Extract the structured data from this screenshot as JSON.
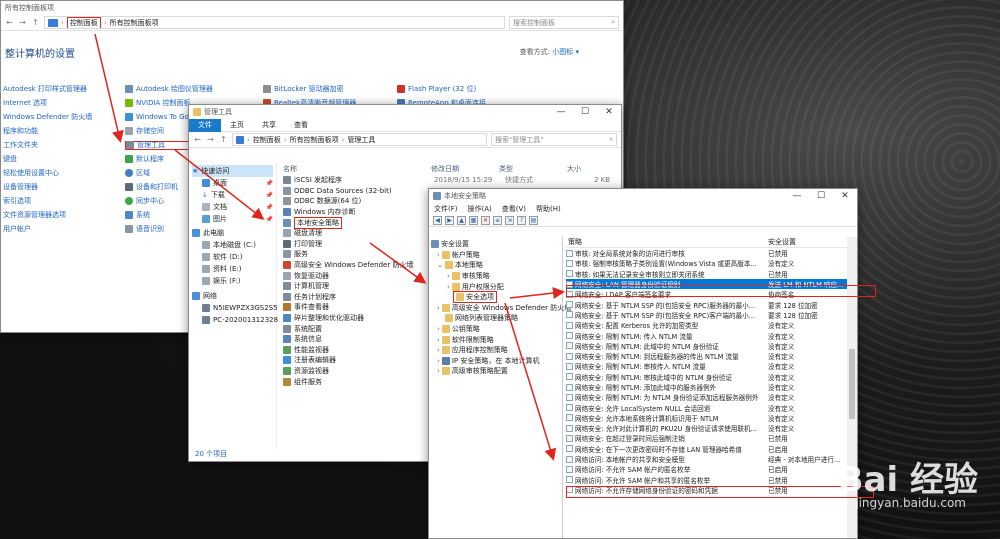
{
  "control_panel": {
    "title": "所有控制面板项",
    "breadcrumb": [
      "控制面板",
      "所有控制面板项"
    ],
    "search_placeholder": "搜索控制面板",
    "heading": "整计算机的设置",
    "view_by_label": "查看方式:",
    "view_by_value": "小图标 ▾",
    "col1": [
      "Autodesk 打印样式管理器",
      "Internet 选项",
      "Windows Defender 防火墙",
      "程序和功能",
      "工作文件夹",
      "键盘",
      "轻松使用设置中心",
      "设备管理器",
      "索引选项",
      "文件资源管理器选项",
      "用户帐户"
    ],
    "col2": [
      "Autodesk 绘图仪管理器",
      "NVIDIA 控制面板",
      "Windows To Go",
      "存储空间",
      "管理工具",
      "默认程序",
      "区域",
      "设备和打印机",
      "同步中心",
      "系统",
      "语音识别"
    ],
    "col3": [
      "BitLocker 驱动器加密",
      "Realtek高清晰音频管理器"
    ],
    "col4": [
      "Flash Player (32 位)",
      "RemoteApp 和桌面连接"
    ]
  },
  "admin_tools": {
    "title": "管理工具",
    "ribbon": [
      "文件",
      "主页",
      "共享",
      "查看"
    ],
    "breadcrumb": [
      "控制面板",
      "所有控制面板项",
      "管理工具"
    ],
    "search_placeholder": "搜索\"管理工具\"",
    "nav": [
      "快速访问",
      "桌面",
      "下载",
      "文档",
      "图片",
      "此电脑",
      "本地磁盘 (C:)",
      "软件 (D:)",
      "资料 (E:)",
      "娱乐 (F:)",
      "网络",
      "N5IEWPZX3GS2S5",
      "PC-202001312328"
    ],
    "col_name": "名称",
    "col_date": "修改日期",
    "col_type": "类型",
    "col_size": "大小",
    "first_row_date": "2018/9/15 15:29",
    "first_row_type": "快捷方式",
    "first_row_size": "2 KB",
    "items": [
      "iSCSI 发起程序",
      "ODBC Data Sources (32-bit)",
      "ODBC 数据源(64 位)",
      "Windows 内存诊断",
      "本地安全策略",
      "磁盘清理",
      "打印管理",
      "服务",
      "高级安全 Windows Defender 防火墙",
      "恢复驱动器",
      "计算机管理",
      "任务计划程序",
      "事件查看器",
      "碎片整理和优化驱动器",
      "系统配置",
      "系统信息",
      "性能监视器",
      "注册表编辑器",
      "资源监视器",
      "组件服务"
    ],
    "status": "20 个项目"
  },
  "local_policy": {
    "title": "本地安全策略",
    "menu": [
      "文件(F)",
      "操作(A)",
      "查看(V)",
      "帮助(H)"
    ],
    "tree": [
      "安全设置",
      "帐户策略",
      "本地策略",
      "审核策略",
      "用户权限分配",
      "安全选项",
      "高级安全 Windows Defender 防火墙",
      "网络列表管理器策略",
      "公钥策略",
      "软件限制策略",
      "应用程序控制策略",
      "IP 安全策略，在 本地计算机",
      "高级审核策略配置"
    ],
    "col_policy": "策略",
    "col_setting": "安全设置",
    "rows": [
      {
        "p": "审核: 对全局系统对象的访问进行审核",
        "s": "已禁用"
      },
      {
        "p": "审核: 强制审核策略子类别设置(Windows Vista 或更高版本...",
        "s": "没有定义"
      },
      {
        "p": "审核: 如果无法记录安全审核则立即关闭系统",
        "s": "已禁用"
      },
      {
        "p": "网络安全: LAN 管理器身份验证级别",
        "s": "发送 LM 和 NTLM 响应..."
      },
      {
        "p": "网络安全: LDAP 客户端签名要求",
        "s": "协商签名"
      },
      {
        "p": "网络安全: 基于 NTLM SSP 的(包括安全 RPC)服务器的最小...",
        "s": "要求 128 位加密"
      },
      {
        "p": "网络安全: 基于 NTLM SSP 的(包括安全 RPC)客户端的最小...",
        "s": "要求 128 位加密"
      },
      {
        "p": "网络安全: 配置 Kerberos 允许的加密类型",
        "s": "没有定义"
      },
      {
        "p": "网络安全: 限制 NTLM: 传入 NTLM 流量",
        "s": "没有定义"
      },
      {
        "p": "网络安全: 限制 NTLM: 此域中的 NTLM 身份验证",
        "s": "没有定义"
      },
      {
        "p": "网络安全: 限制 NTLM: 到远程服务器的传出 NTLM 流量",
        "s": "没有定义"
      },
      {
        "p": "网络安全: 限制 NTLM: 审核传入 NTLM 流量",
        "s": "没有定义"
      },
      {
        "p": "网络安全: 限制 NTLM: 审核此域中的 NTLM 身份验证",
        "s": "没有定义"
      },
      {
        "p": "网络安全: 限制 NTLM: 添加此域中的服务器例外",
        "s": "没有定义"
      },
      {
        "p": "网络安全: 限制 NTLM: 为 NTLM 身份验证添加远程服务器例外",
        "s": "没有定义"
      },
      {
        "p": "网络安全: 允许 LocalSystem NULL 会话回退",
        "s": "没有定义"
      },
      {
        "p": "网络安全: 允许本地系统将计算机标识用于 NTLM",
        "s": "没有定义"
      },
      {
        "p": "网络安全: 允许对此计算机的 PKU2U 身份验证请求使用联机...",
        "s": "没有定义"
      },
      {
        "p": "网络安全: 在超过登录时间后强制注销",
        "s": "已禁用"
      },
      {
        "p": "网络安全: 在下一次更改密码时不存储 LAN 管理器哈希值",
        "s": "已启用"
      },
      {
        "p": "网络访问: 本地帐户的共享和安全模型",
        "s": "经典 - 对本地用户进行..."
      },
      {
        "p": "网络访问: 不允许 SAM 帐户的匿名枚举",
        "s": "已启用"
      },
      {
        "p": "网络访问: 不允许 SAM 帐户和共享的匿名枚举",
        "s": "已禁用"
      },
      {
        "p": "网络访问: 不允许存储网络身份验证的密码和凭据",
        "s": "已禁用"
      }
    ]
  },
  "watermark": {
    "brand": "Bai 经验",
    "sub": "jingyan.baidu.com"
  },
  "colors": {
    "accent": "#1979ca",
    "highlight": "#e0241e",
    "link": "#1d64c6",
    "selection": "#0078d7"
  }
}
